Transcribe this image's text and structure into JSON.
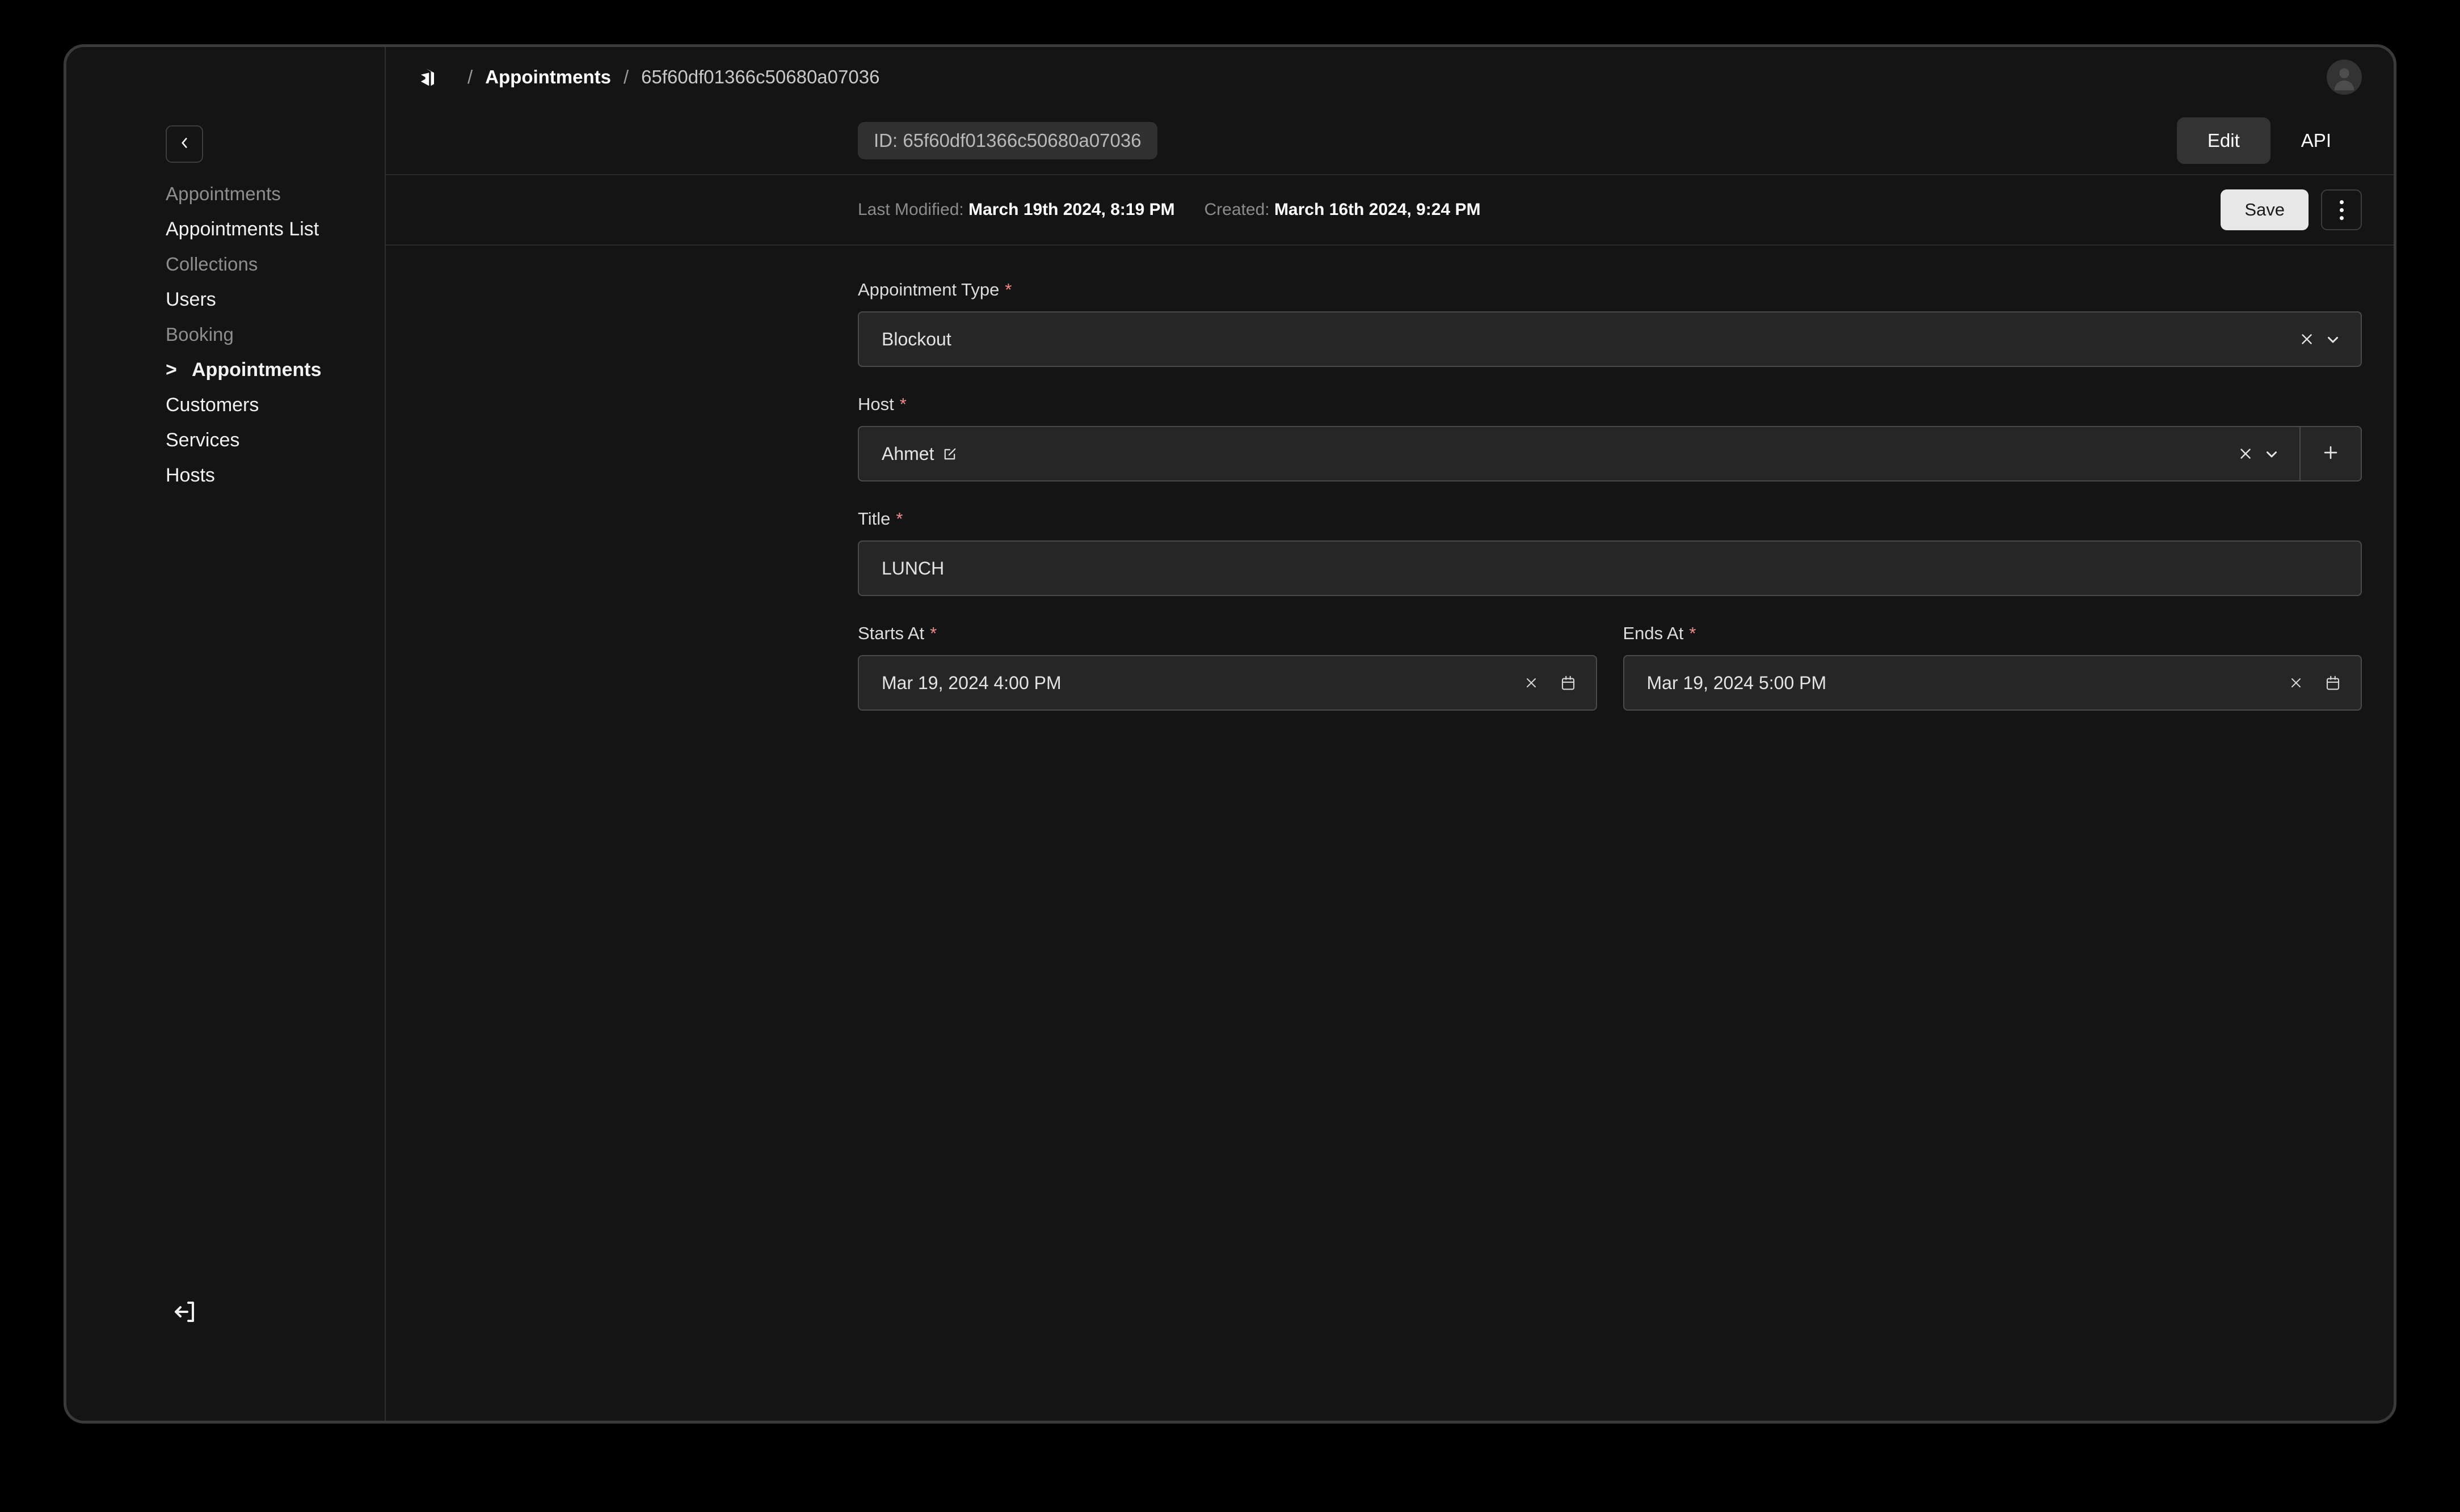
{
  "sidebar": {
    "collapse_icon": "chevron-left-icon",
    "logout_icon": "logout-icon",
    "sections": [
      {
        "label": "Appointments",
        "chevron": "chevron-up-icon",
        "items": [
          {
            "label": "Appointments List",
            "active": false
          }
        ]
      },
      {
        "label": "Collections",
        "chevron": "chevron-up-icon",
        "items": [
          {
            "label": "Users",
            "active": false
          }
        ]
      },
      {
        "label": "Booking",
        "chevron": "chevron-up-icon",
        "items": [
          {
            "label": "Appointments",
            "active": true
          },
          {
            "label": "Customers",
            "active": false
          },
          {
            "label": "Services",
            "active": false
          },
          {
            "label": "Hosts",
            "active": false
          }
        ]
      }
    ]
  },
  "topbar": {
    "logo_icon": "app-logo-icon",
    "separator": "/",
    "breadcrumb_link": "Appointments",
    "breadcrumb_current": "65f60df01366c50680a07036",
    "avatar_icon": "user-avatar-icon"
  },
  "idbar": {
    "id_pill": "ID: 65f60df01366c50680a07036",
    "tabs": [
      {
        "label": "Edit",
        "active": true
      },
      {
        "label": "API",
        "active": false
      }
    ]
  },
  "metabar": {
    "last_modified_key": "Last Modified:",
    "last_modified_value": "March 19th 2024, 8:19 PM",
    "created_key": "Created:",
    "created_value": "March 16th 2024, 9:24 PM",
    "save_label": "Save",
    "kebab_icon": "more-vertical-icon"
  },
  "form": {
    "required_marker": "*",
    "appointment_type": {
      "label": "Appointment Type",
      "value": "Blockout",
      "clear_icon": "close-icon",
      "dropdown_icon": "chevron-down-icon"
    },
    "host": {
      "label": "Host",
      "value": "Ahmet",
      "link_icon": "external-link-icon",
      "clear_icon": "close-icon",
      "dropdown_icon": "chevron-down-icon",
      "add_label": "+",
      "add_icon": "plus-icon"
    },
    "title": {
      "label": "Title",
      "value": "LUNCH",
      "placeholder": ""
    },
    "starts_at": {
      "label": "Starts At",
      "value": "Mar 19, 2024 4:00 PM",
      "clear_icon": "close-icon",
      "calendar_icon": "calendar-icon"
    },
    "ends_at": {
      "label": "Ends At",
      "value": "Mar 19, 2024 5:00 PM",
      "clear_icon": "close-icon",
      "calendar_icon": "calendar-icon"
    }
  },
  "colors": {
    "page_background": "#000000",
    "window_background": "#141414",
    "window_border": "#3a3a3a",
    "divider": "#2b2b2b",
    "input_background": "#262626",
    "input_border": "#4a4a4a",
    "accent_required": "#f08a8a",
    "save_button": "#e8e8e8",
    "active_tab": "#333333",
    "muted_text": "#8c8c8c"
  }
}
